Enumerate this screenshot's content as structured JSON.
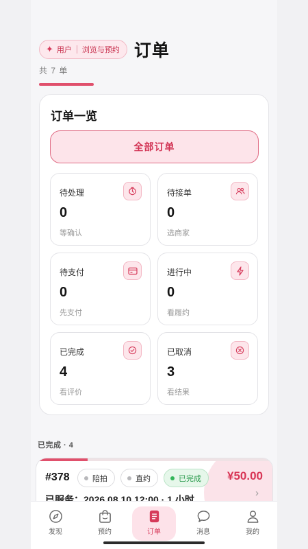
{
  "header": {
    "role_chip": {
      "role": "用户",
      "mode": "浏览与预约"
    },
    "title": "订单",
    "count_text": "共 7 单"
  },
  "overview": {
    "title": "订单一览",
    "all_button": "全部订单",
    "stats": [
      {
        "label": "待处理",
        "value": "0",
        "sub": "等确认",
        "icon": "timer-icon"
      },
      {
        "label": "待接单",
        "value": "0",
        "sub": "选商家",
        "icon": "users-icon"
      },
      {
        "label": "待支付",
        "value": "0",
        "sub": "先支付",
        "icon": "card-icon"
      },
      {
        "label": "进行中",
        "value": "0",
        "sub": "看履约",
        "icon": "bolt-icon"
      },
      {
        "label": "已完成",
        "value": "4",
        "sub": "看评价",
        "icon": "check-circle-icon"
      },
      {
        "label": "已取消",
        "value": "3",
        "sub": "看结果",
        "icon": "x-circle-icon"
      }
    ]
  },
  "section": {
    "label": "已完成 · 4"
  },
  "order": {
    "number": "#378",
    "tags": [
      "陪拍",
      "直约",
      "已完成"
    ],
    "price": "¥50.00",
    "service": "已服务：2026.08.10 12:00 · 1 小时"
  },
  "tabs": [
    {
      "label": "发现",
      "icon": "compass-icon"
    },
    {
      "label": "预约",
      "icon": "bag-icon"
    },
    {
      "label": "订单",
      "icon": "order-icon",
      "active": true
    },
    {
      "label": "消息",
      "icon": "chat-icon"
    },
    {
      "label": "我的",
      "icon": "profile-icon"
    }
  ],
  "colors": {
    "accent": "#e0506c",
    "accent_light": "#fde4ea",
    "success": "#34b65a"
  }
}
